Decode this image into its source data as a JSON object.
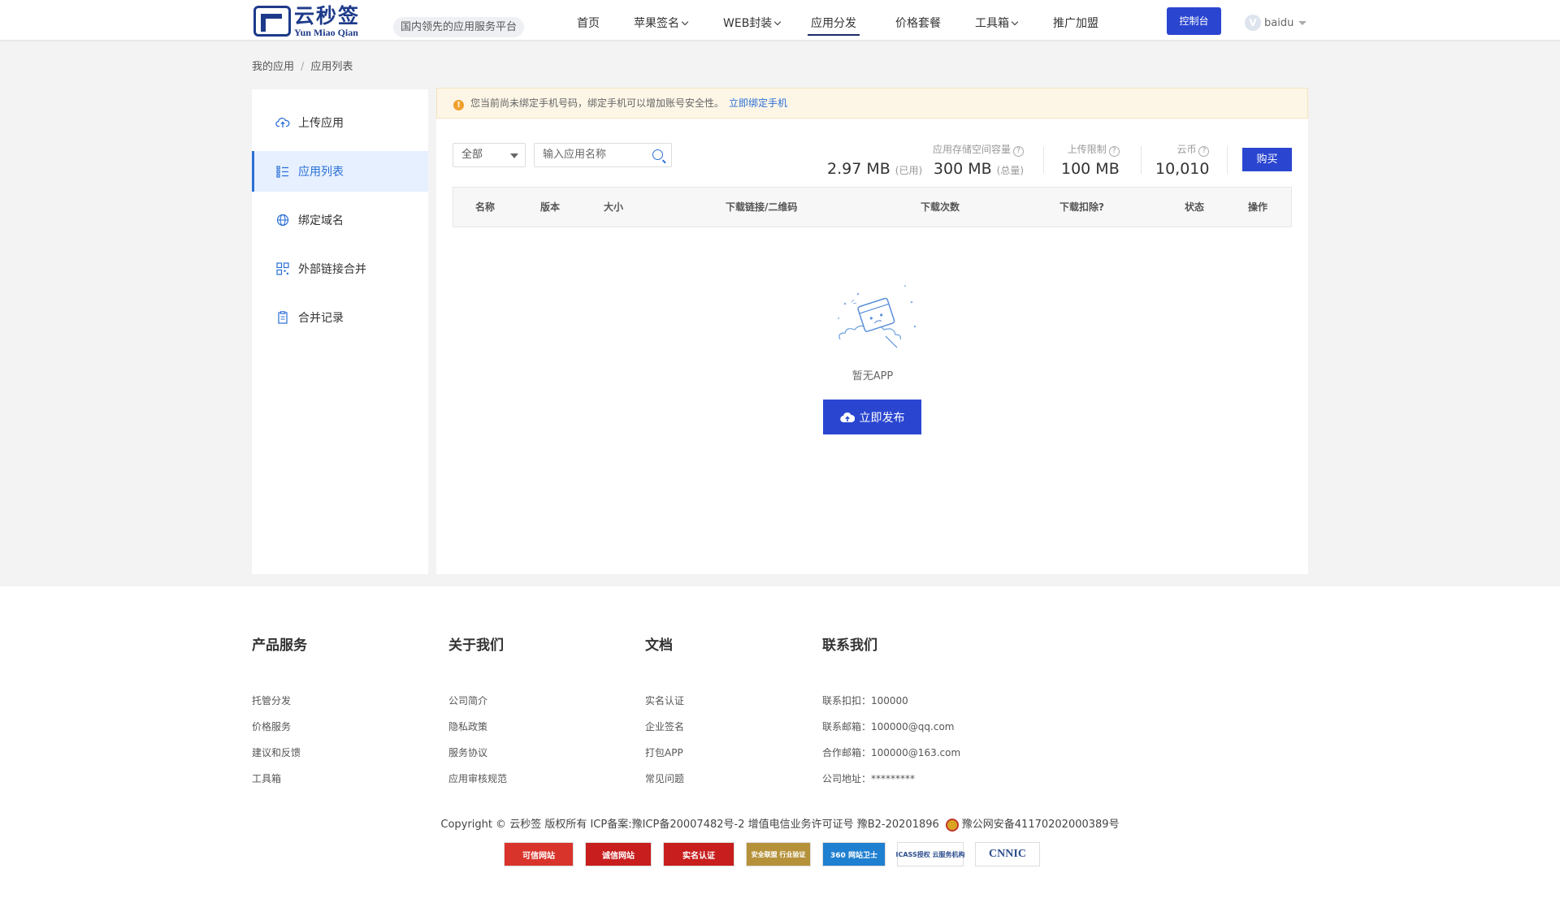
{
  "header": {
    "logo_cn": "云秒签",
    "logo_en": "Yun Miao Qian",
    "slogan": "国内领先的应用服务平台",
    "nav": [
      {
        "label": "首页",
        "dropdown": false,
        "active": false
      },
      {
        "label": "苹果签名",
        "dropdown": true,
        "active": false
      },
      {
        "label": "WEB封装",
        "dropdown": true,
        "active": false
      },
      {
        "label": "应用分发",
        "dropdown": false,
        "active": true
      },
      {
        "label": "价格套餐",
        "dropdown": false,
        "active": false
      },
      {
        "label": "工具箱",
        "dropdown": true,
        "active": false
      },
      {
        "label": "推广加盟",
        "dropdown": false,
        "active": false
      }
    ],
    "console_label": "控制台",
    "user_badge": "V",
    "username": "baidu"
  },
  "breadcrumb": {
    "root": "我的应用",
    "separator": "/",
    "current": "应用列表"
  },
  "sidebar": {
    "items": [
      {
        "label": "上传应用",
        "icon": "cloud-upload-icon",
        "active": false
      },
      {
        "label": "应用列表",
        "icon": "list-icon",
        "active": true
      },
      {
        "label": "绑定域名",
        "icon": "globe-icon",
        "active": false
      },
      {
        "label": "外部链接合并",
        "icon": "qrcode-icon",
        "active": false
      },
      {
        "label": "合并记录",
        "icon": "clipboard-icon",
        "active": false
      }
    ]
  },
  "warning": {
    "icon": "!",
    "text": "您当前尚未绑定手机号码，绑定手机可以增加账号安全性。",
    "link": "立即绑定手机"
  },
  "filters": {
    "select_value": "全部",
    "search_placeholder": "输入应用名称"
  },
  "stats": {
    "used_value": "2.97 MB",
    "used_suffix": "(已用)",
    "storage_label": "应用存储空间容量",
    "storage_value": "300 MB",
    "storage_suffix": "(总量)",
    "upload_label": "上传限制",
    "upload_value": "100 MB",
    "coin_label": "云币",
    "coin_value": "10,010",
    "help_icon": "?",
    "buy_label": "购买"
  },
  "table": {
    "columns": [
      "名称",
      "版本",
      "大小",
      "下载链接/二维码",
      "下载次数",
      "下载扣除?",
      "状态",
      "操作"
    ],
    "rows": []
  },
  "empty": {
    "text": "暂无APP",
    "button_label": "立即发布"
  },
  "footer": {
    "columns": [
      {
        "title": "产品服务",
        "links": [
          "托管分发",
          "价格服务",
          "建议和反馈",
          "工具箱"
        ]
      },
      {
        "title": "关于我们",
        "links": [
          "公司简介",
          "隐私政策",
          "服务协议",
          "应用审核规范"
        ]
      },
      {
        "title": "文档",
        "links": [
          "实名认证",
          "企业签名",
          "打包APP",
          "常见问题"
        ]
      },
      {
        "title": "联系我们",
        "links": [
          "联系扣扣：100000",
          "联系邮箱：100000@qq.com",
          "合作邮箱：100000@163.com",
          "公司地址：*********"
        ]
      }
    ],
    "copyright": "Copyright © 云秒签 版权所有 ICP备案:豫ICP备20007482号-2 增值电信业务许可证号 豫B2-20201896",
    "police_record": "豫公网安备41170202000389号",
    "badges": [
      {
        "label": "可信网站",
        "color": "#d9342b"
      },
      {
        "label": "诚信网站",
        "color": "#c81e1e"
      },
      {
        "label": "实名认证",
        "color": "#c81e1e"
      },
      {
        "label": "安全联盟 行业验证",
        "color": "#b5913a"
      },
      {
        "label": "360 网站卫士",
        "color": "#1f7fd0"
      },
      {
        "label": "ICASS授权 云服务机构",
        "color": "#2c4d8f"
      },
      {
        "label": "CNNIC",
        "color": "#2c4d8f"
      }
    ]
  },
  "colors": {
    "primary": "#2a46d0",
    "link": "#2a6fd6",
    "active_bg": "#e6f0ff",
    "warn_bg": "#fdf6e7",
    "warn_icon": "#f0a02c",
    "page_bg": "#f3f3f3"
  }
}
